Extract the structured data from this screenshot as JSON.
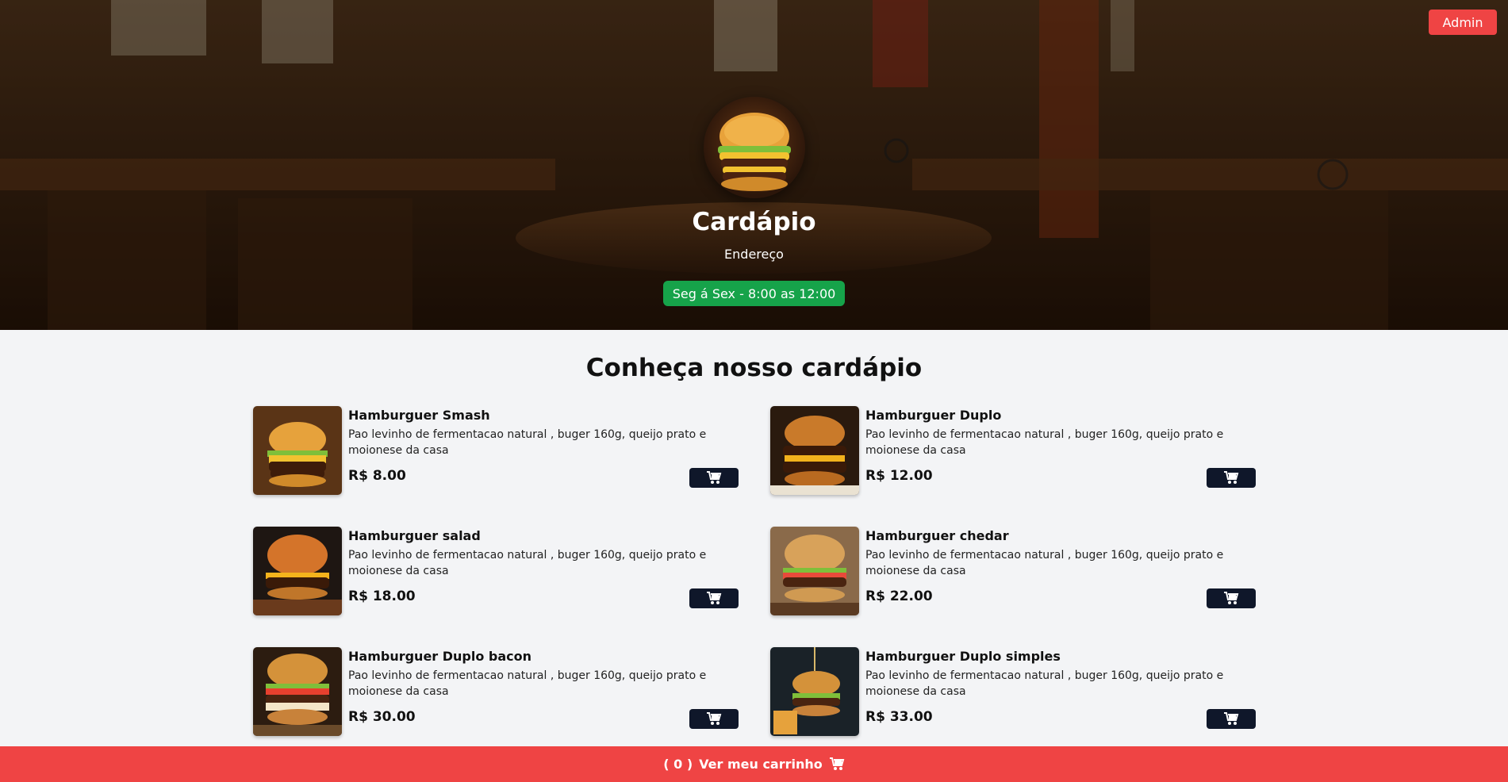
{
  "header": {
    "admin_label": "Admin",
    "title": "Cardápio",
    "address": "Endereço",
    "hours": "Seg á Sex - 8:00 as 12:00"
  },
  "menu": {
    "title": "Conheça nosso cardápio",
    "items": [
      {
        "name": "Hamburguer Smash",
        "description": "Pao levinho de fermentacao natural , buger 160g, queijo prato e moionese da casa",
        "price": "R$ 8.00"
      },
      {
        "name": "Hamburguer Duplo",
        "description": "Pao levinho de fermentacao natural , buger 160g, queijo prato e moionese da casa",
        "price": "R$ 12.00"
      },
      {
        "name": "Hamburguer salad",
        "description": "Pao levinho de fermentacao natural , buger 160g, queijo prato e moionese da casa",
        "price": "R$ 18.00"
      },
      {
        "name": "Hamburguer chedar",
        "description": "Pao levinho de fermentacao natural , buger 160g, queijo prato e moionese da casa",
        "price": "R$ 22.00"
      },
      {
        "name": "Hamburguer Duplo bacon",
        "description": "Pao levinho de fermentacao natural , buger 160g, queijo prato e moionese da casa",
        "price": "R$ 30.00"
      },
      {
        "name": "Hamburguer Duplo simples",
        "description": "Pao levinho de fermentacao natural , buger 160g, queijo prato e moionese da casa",
        "price": "R$ 33.00"
      }
    ]
  },
  "cart": {
    "count_text": "( 0 )",
    "label": "Ver meu carrinho"
  },
  "colors": {
    "accent_red": "#ef4444",
    "badge_green": "#16a34a",
    "button_dark": "#0f172a"
  },
  "icons": {
    "cart": "cart-icon"
  }
}
